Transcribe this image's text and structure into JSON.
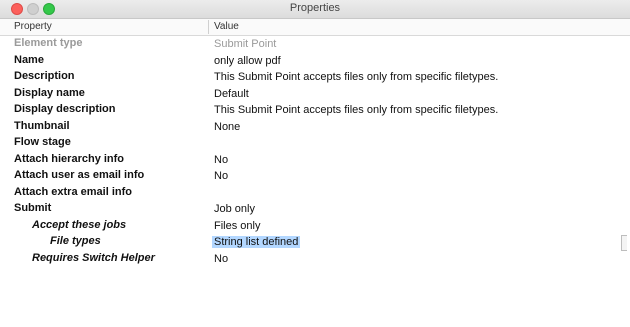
{
  "window": {
    "title": "Properties"
  },
  "table": {
    "headers": {
      "property": "Property",
      "value": "Value"
    },
    "rows": [
      {
        "property": "Element type",
        "value": "Submit Point",
        "level": 0,
        "disabled": true
      },
      {
        "property": "Name",
        "value": "only allow pdf",
        "level": 0
      },
      {
        "property": "Description",
        "value": "This Submit Point accepts files only from specific filetypes.",
        "level": 0
      },
      {
        "property": "Display name",
        "value": "Default",
        "level": 0
      },
      {
        "property": "Display description",
        "value": "This Submit Point accepts files only from specific filetypes.",
        "level": 0
      },
      {
        "property": "Thumbnail",
        "value": "None",
        "level": 0
      },
      {
        "property": "Flow stage",
        "value": "",
        "level": 0
      },
      {
        "property": "Attach hierarchy info",
        "value": "No",
        "level": 0
      },
      {
        "property": "Attach user as email info",
        "value": "No",
        "level": 0
      },
      {
        "property": "Attach extra email info",
        "value": "",
        "level": 0
      },
      {
        "property": "Submit",
        "value": "Job only",
        "level": 0
      },
      {
        "property": "Accept these jobs",
        "value": "Files only",
        "level": 1
      },
      {
        "property": "File types",
        "value": "String list defined",
        "level": 2,
        "selected": true
      },
      {
        "property": "Requires Switch Helper",
        "value": "No",
        "level": 1
      }
    ]
  }
}
